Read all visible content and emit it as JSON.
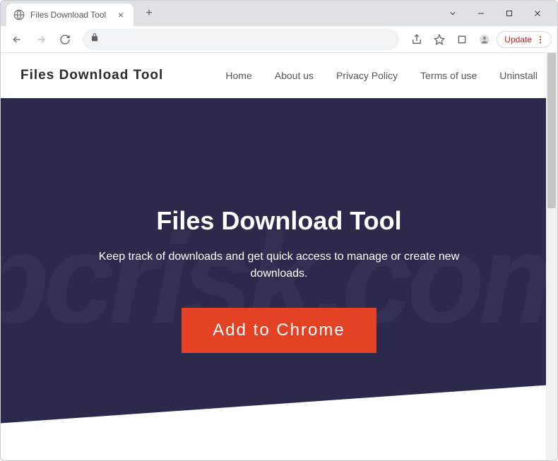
{
  "window": {
    "tab_title": "Files Download Tool"
  },
  "toolbar": {
    "update_label": "Update"
  },
  "page": {
    "brand": "Files Download Tool",
    "nav": {
      "home": "Home",
      "about": "About us",
      "privacy": "Privacy Policy",
      "terms": "Terms of use",
      "uninstall": "Uninstall"
    },
    "hero": {
      "title": "Files Download Tool",
      "subtitle": "Keep track of downloads and get quick access to manage or create new downloads.",
      "cta": "Add to Chrome"
    }
  },
  "colors": {
    "hero_bg": "#2b2a4c",
    "cta_bg": "#e34224"
  }
}
